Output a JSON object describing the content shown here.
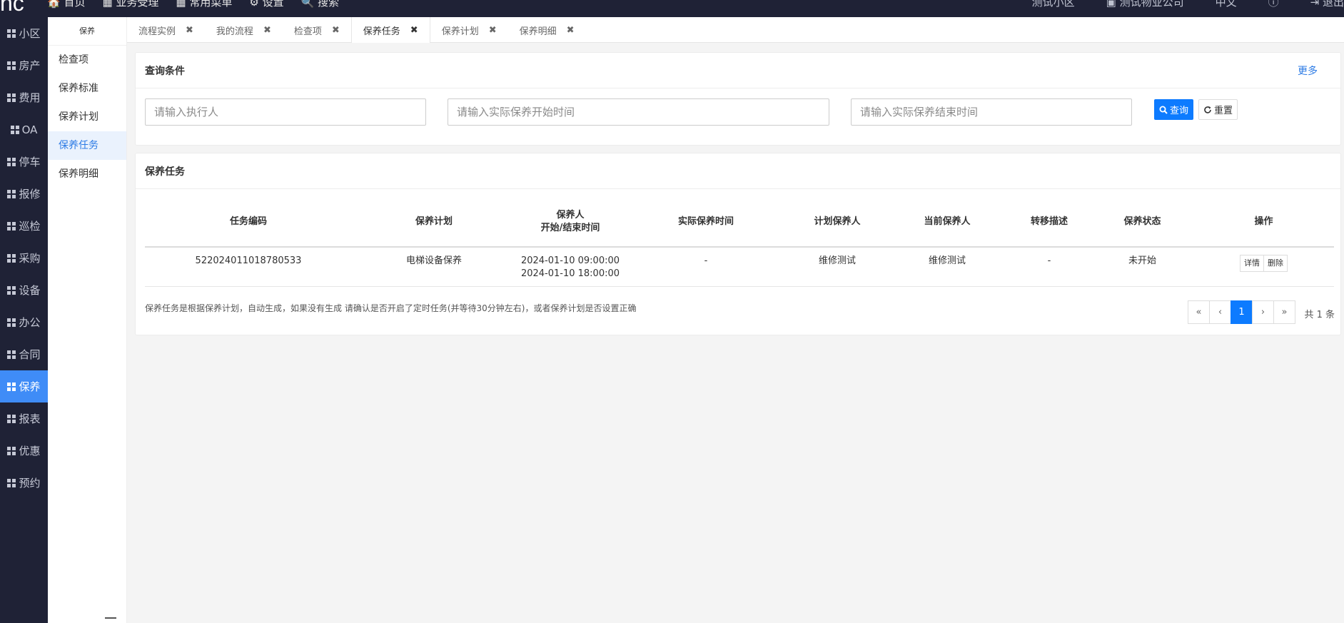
{
  "topbar": {
    "logo": "hc",
    "nav": [
      "🏠 首页",
      "▦ 业务受理",
      "▦ 常用菜单",
      "⚙ 设置",
      "🔍 搜索"
    ],
    "right": [
      "测试小区",
      "▣ 测试物业公司",
      "中文",
      "ⓘ",
      "⇥ 退出"
    ]
  },
  "iconbar": {
    "items": [
      {
        "label": "小区"
      },
      {
        "label": "房产"
      },
      {
        "label": "费用"
      },
      {
        "label": "OA"
      },
      {
        "label": "停车"
      },
      {
        "label": "报修"
      },
      {
        "label": "巡检"
      },
      {
        "label": "采购"
      },
      {
        "label": "设备"
      },
      {
        "label": "办公"
      },
      {
        "label": "合同"
      },
      {
        "label": "保养"
      },
      {
        "label": "报表"
      },
      {
        "label": "优惠"
      },
      {
        "label": "预约"
      }
    ],
    "active_index": 11
  },
  "subbar": {
    "title": "保养",
    "items": [
      "检查项",
      "保养标准",
      "保养计划",
      "保养任务",
      "保养明细"
    ],
    "active_index": 3
  },
  "tabs": [
    {
      "label": "流程实例",
      "close": "✖"
    },
    {
      "label": "我的流程",
      "close": "✖"
    },
    {
      "label": "检查项",
      "close": "✖"
    },
    {
      "label": "保养任务",
      "close": "✖"
    },
    {
      "label": "保养计划",
      "close": "✖"
    },
    {
      "label": "保养明细",
      "close": "✖"
    }
  ],
  "query": {
    "title": "查询条件",
    "more": "更多",
    "executor_placeholder": "请输入执行人",
    "start_placeholder": "请输入实际保养开始时间",
    "end_placeholder": "请输入实际保养结束时间",
    "search_label": "查询",
    "reset_label": "重置"
  },
  "tasks": {
    "title": "保养任务",
    "headers": {
      "code": "任务编码",
      "plan": "保养计划",
      "person_l1": "保养人",
      "person_l2": "开始/结束时间",
      "actual": "实际保养时间",
      "plan_person": "计划保养人",
      "current_person": "当前保养人",
      "transfer": "转移描述",
      "status": "保养状态",
      "op": "操作"
    },
    "rows": [
      {
        "code": "522024011018780533",
        "plan": "电梯设备保养",
        "start": "2024-01-10 09:00:00",
        "end": "2024-01-10 18:00:00",
        "actual": "-",
        "plan_person": "维修测试",
        "current_person": "维修测试",
        "transfer": "-",
        "status": "未开始",
        "detail": "详情",
        "delete": "删除"
      }
    ],
    "note": "保养任务是根据保养计划，自动生成，如果没有生成 请确认是否开启了定时任务(并等待30分钟左右)，或者保养计划是否设置正确",
    "pager": {
      "first": "«",
      "prev": "‹",
      "current": "1",
      "next": "›",
      "last": "»",
      "total": "共 1 条"
    }
  }
}
